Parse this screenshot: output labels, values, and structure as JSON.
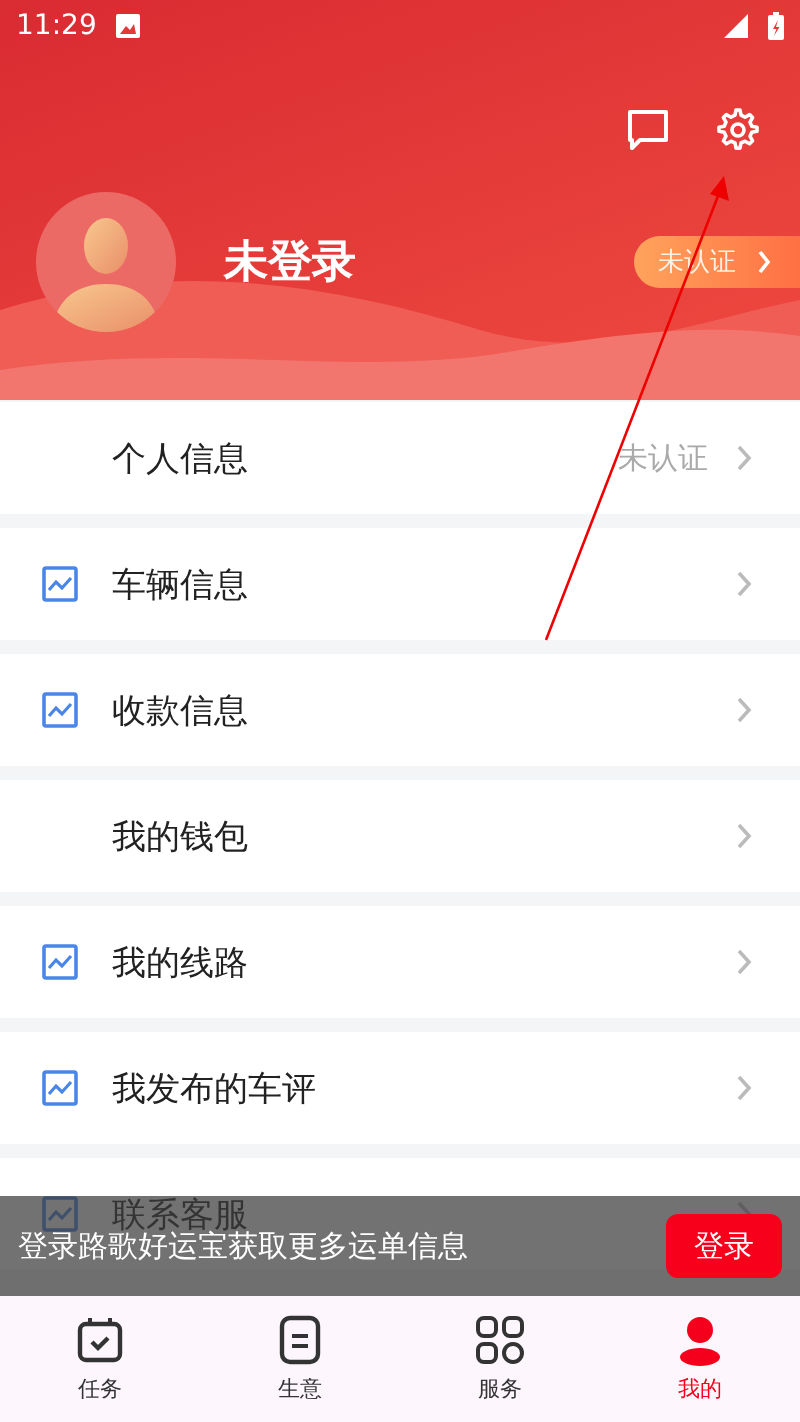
{
  "status_bar": {
    "time": "11:29"
  },
  "profile": {
    "name": "未登录",
    "badge": "未认证"
  },
  "menu": [
    {
      "kind": "plain",
      "label": "个人信息",
      "value": "未认证"
    },
    {
      "kind": "icon",
      "label": "车辆信息"
    },
    {
      "kind": "icon",
      "label": "收款信息"
    },
    {
      "kind": "plain",
      "label": "我的钱包"
    },
    {
      "kind": "icon",
      "label": "我的线路"
    },
    {
      "kind": "icon",
      "label": "我发布的车评"
    },
    {
      "kind": "icon",
      "label": "联系客服"
    }
  ],
  "login_banner": {
    "text": "登录路歌好运宝获取更多运单信息",
    "button": "登录"
  },
  "nav": [
    {
      "kind": "tasks",
      "label": "任务",
      "selected": false
    },
    {
      "kind": "business",
      "label": "生意",
      "selected": false
    },
    {
      "kind": "services",
      "label": "服务",
      "selected": false
    },
    {
      "kind": "mine",
      "label": "我的",
      "selected": true
    }
  ]
}
